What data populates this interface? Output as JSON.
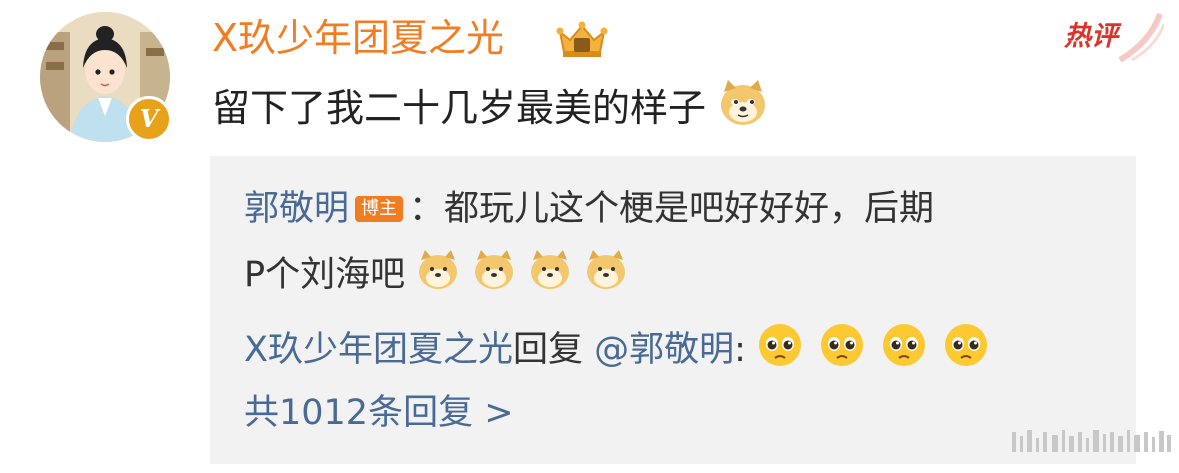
{
  "comment": {
    "username": "X玖少年团夏之光",
    "hot_label": "热评",
    "text": "留下了我二十几岁最美的样子",
    "emoji": "doge-emoji",
    "avatar_badge": "V"
  },
  "reply_box": {
    "reply1": {
      "author": "郭敬明",
      "author_tag": "博主",
      "sep": "：",
      "text_line1": "都玩儿这个梗是吧好好好，后期",
      "text_line2": "P个刘海吧",
      "emoji": "doge-emoji",
      "emoji_count": 4
    },
    "reply2": {
      "author": "X玖少年团夏之光",
      "reply_word": "回复",
      "mention": "@郭敬明",
      "colon": ":",
      "emoji": "pleading-face-emoji",
      "emoji_count": 4
    },
    "more_replies": "共1012条回复 >"
  },
  "colors": {
    "username": "#f27c21",
    "link": "#496a97",
    "hot": "#d9342b",
    "box_bg": "#f2f2f2"
  }
}
